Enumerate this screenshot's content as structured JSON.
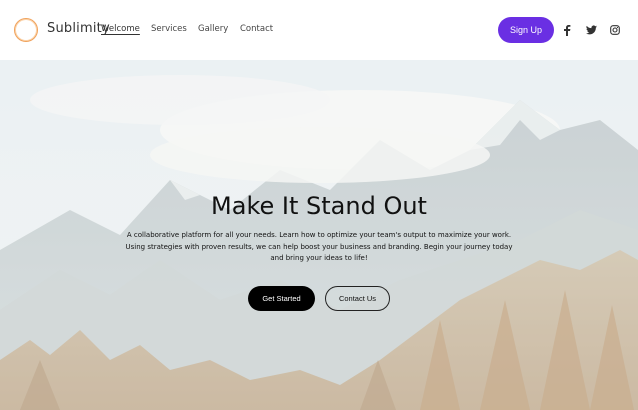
{
  "header": {
    "brand": "Sublimity",
    "nav": [
      "Welcome",
      "Services",
      "Gallery",
      "Contact"
    ],
    "signup_label": "Sign Up",
    "social": [
      {
        "icon": "facebook-icon",
        "glyph": "f"
      },
      {
        "icon": "twitter-icon",
        "glyph": "t"
      },
      {
        "icon": "instagram-icon",
        "glyph": "◎"
      }
    ]
  },
  "hero": {
    "title": "Make It Stand Out",
    "paragraph": "A collaborative platform for all your needs. Learn how to optimize your team's output to maximize your work. Using strategies with proven results, we can help boost your business and branding. Begin your journey today and bring your ideas to life!",
    "primary_button": "Get Started",
    "secondary_button": "Contact Us"
  },
  "colors": {
    "accent": "#6a2fe3",
    "logo_ring": "#f0a15a"
  }
}
